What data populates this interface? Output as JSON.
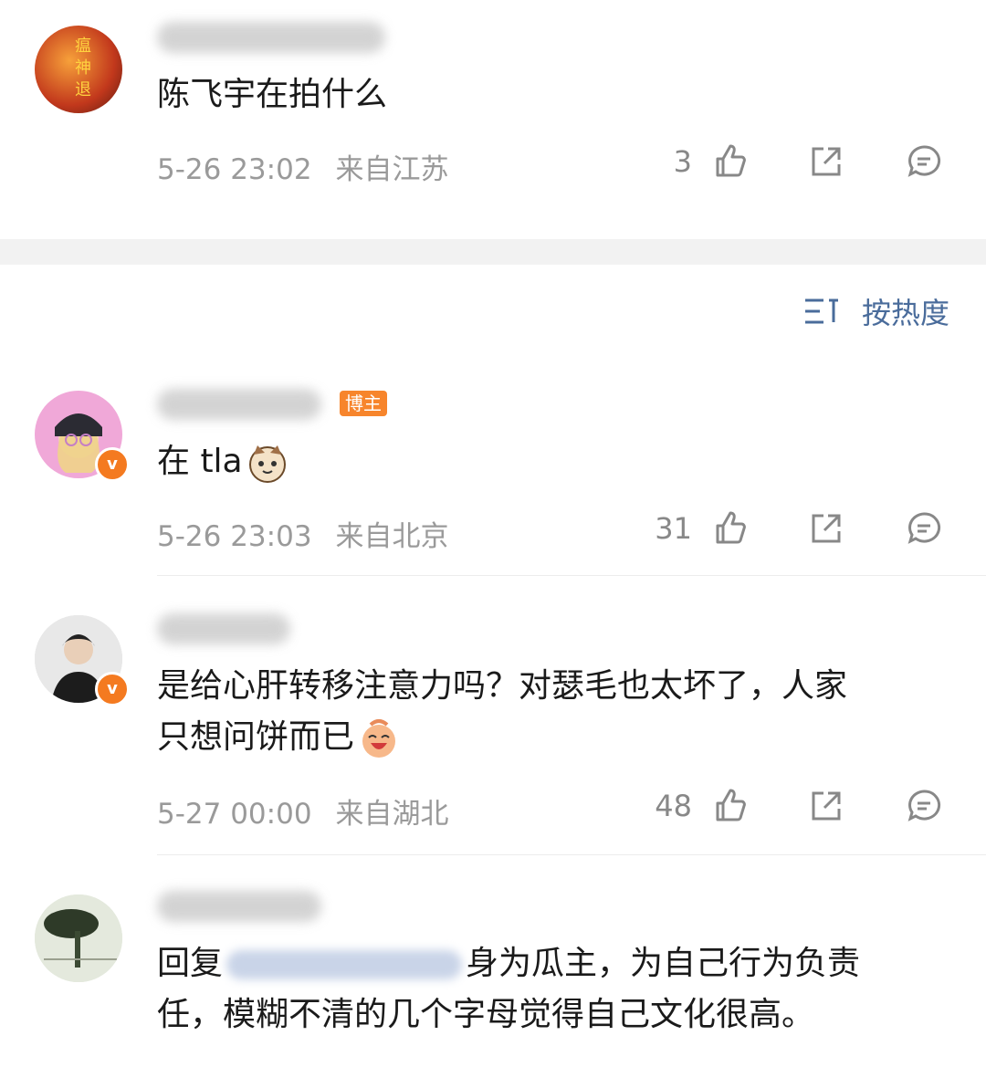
{
  "post": {
    "text": "陈飞宇在拍什么",
    "time": "5-26 23:02",
    "location": "来自江苏",
    "likes": "3"
  },
  "sort": {
    "label": "按热度"
  },
  "comments": [
    {
      "badge": "博主",
      "text": "在 tla",
      "time": "5-26 23:03",
      "location": "来自北京",
      "likes": "31"
    },
    {
      "text_line1": "是给心肝转移注意力吗？对瑟毛也太坏了，人家",
      "text_line2": "只想问饼而已",
      "time": "5-27 00:00",
      "location": "来自湖北",
      "likes": "48"
    },
    {
      "reply_prefix": "回复",
      "text_line1": "身为瓜主，为自己行为负责",
      "text_line2": "任，模糊不清的几个字母觉得自己文化很高。"
    }
  ],
  "colors": {
    "accent": "#4a6c9b",
    "badge": "#f7852c",
    "verified": "#f47a20"
  }
}
